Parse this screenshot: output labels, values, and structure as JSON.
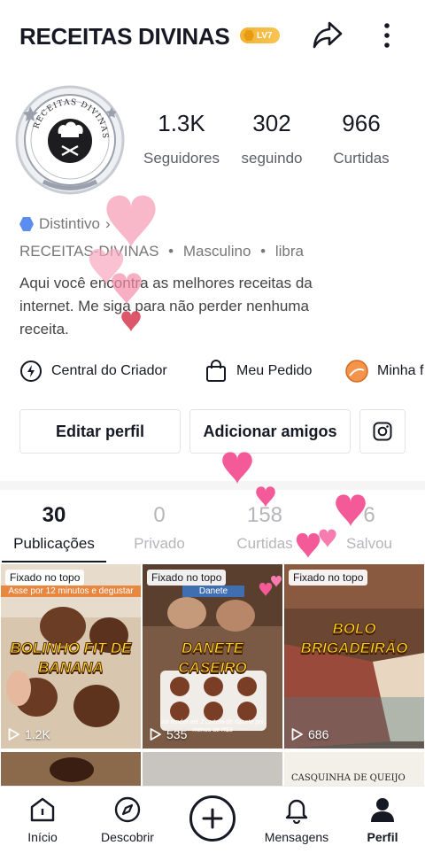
{
  "header": {
    "title": "RECEITAS DIVINAS",
    "level_badge": "LV7",
    "share_icon": "share-arrow-icon",
    "more_icon": "more-vertical-icon"
  },
  "profile": {
    "avatar_text_top": "RECEITAS DIVINAS",
    "stats": [
      {
        "value": "1.3K",
        "label": "Seguidores"
      },
      {
        "value": "302",
        "label": "seguindo"
      },
      {
        "value": "966",
        "label": "Curtidas"
      }
    ],
    "badge_label": "Distintivo",
    "badge_chevron": "›",
    "username": "RECEITAS-DIVINAS",
    "gender": "Masculino",
    "zodiac": "libra",
    "separator": "•",
    "bio": "Aqui você encontra as melhores receitas da internet. Me siga para não perder nenhuma receita."
  },
  "tools": [
    {
      "label": "Central do Criador",
      "icon": "lightning-circle-icon"
    },
    {
      "label": "Meu Pedido",
      "icon": "shopping-bag-icon"
    },
    {
      "label": "Minha f",
      "icon": "orange-avatar-icon"
    }
  ],
  "actions": {
    "edit_profile": "Editar perfil",
    "add_friends": "Adicionar amigos",
    "instagram_icon": "instagram-icon"
  },
  "tabs": [
    {
      "count": "30",
      "label": "Publicações",
      "active": true
    },
    {
      "count": "0",
      "label": "Privado",
      "active": false
    },
    {
      "count": "158",
      "label": "Curtidas",
      "active": false
    },
    {
      "count": "6",
      "label": "Salvou",
      "active": false
    }
  ],
  "videos": [
    {
      "pinned": "Fixado no topo",
      "caption_line1": "BOLINHO FIT DE",
      "caption_line2": "BANANA",
      "banner": "Asse por 12 minutos e degustar",
      "views": "1.2K"
    },
    {
      "pinned": "Fixado no topo",
      "caption_line1": "DANETE",
      "caption_line2": "CASEIRO",
      "banner": "Danete",
      "subtext": "vai render até 2 cartela de danete por menos de R$3",
      "views": "535"
    },
    {
      "pinned": "Fixado no topo",
      "caption_line1": "BOLO",
      "caption_line2": "BRIGADEIRÃO",
      "views": "686"
    }
  ],
  "row2_captions": [
    "",
    "",
    "CASQUINHA DE QUEIJO"
  ],
  "bottom_nav": [
    {
      "label": "Início",
      "icon": "home-icon"
    },
    {
      "label": "Descobrir",
      "icon": "compass-icon"
    },
    {
      "label": "",
      "icon": "plus-icon"
    },
    {
      "label": "Mensagens",
      "icon": "bell-icon"
    },
    {
      "label": "Perfil",
      "icon": "person-icon"
    }
  ],
  "colors": {
    "text": "#161823",
    "muted": "#777777",
    "level_badge": "#f3b234",
    "caption_yellow": "#ffe230",
    "heart_pink": "#f66a9c"
  }
}
